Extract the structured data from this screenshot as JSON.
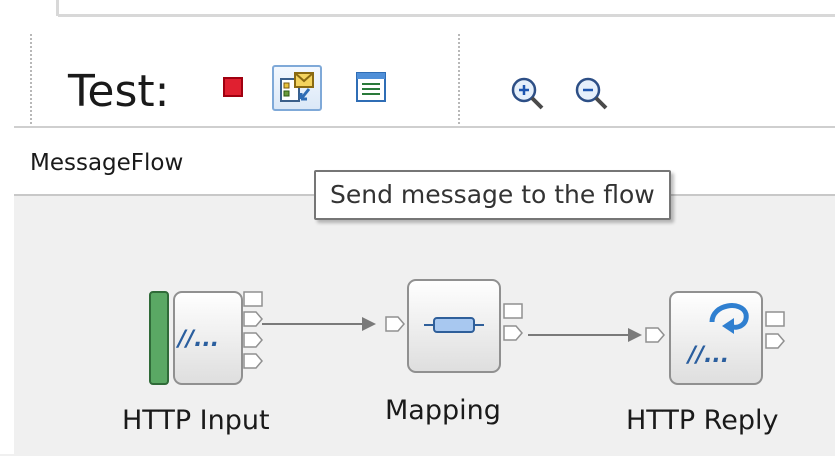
{
  "toolbar": {
    "test_label": "Test:",
    "buttons": [
      {
        "icon": "stop-icon",
        "active": false
      },
      {
        "icon": "send-message-icon",
        "active": true
      },
      {
        "icon": "list-view-icon",
        "active": false
      }
    ],
    "zoom": [
      {
        "icon": "zoom-in-icon"
      },
      {
        "icon": "zoom-out-icon"
      }
    ]
  },
  "pathbar": {
    "label": "MessageFlow"
  },
  "tooltip": {
    "text": "Send message to the flow"
  },
  "flow": {
    "nodes": [
      {
        "label": "HTTP Input",
        "icon": "http-input-icon"
      },
      {
        "label": "Mapping",
        "icon": "mapping-icon"
      },
      {
        "label": "HTTP Reply",
        "icon": "http-reply-icon"
      }
    ]
  },
  "colors": {
    "stop": "#e02030",
    "active_border": "#7fa9d8",
    "canvas_bg": "#f0f0f0",
    "input_bar": "#5aa864",
    "connector": "#7a7a7a"
  }
}
